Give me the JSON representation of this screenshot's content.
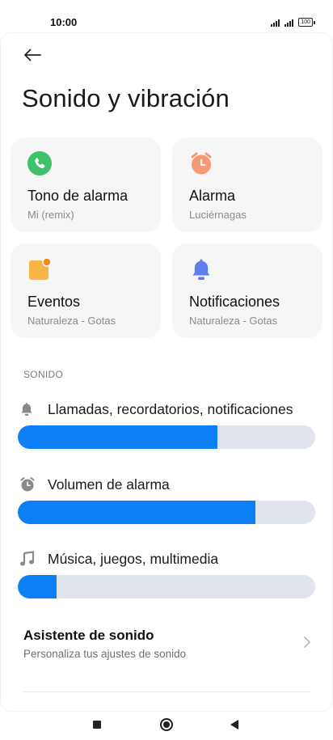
{
  "status_bar": {
    "time": "10:00",
    "battery": "100"
  },
  "header": {
    "back_icon": "arrow-left-icon",
    "title": "Sonido y vibración"
  },
  "tiles": [
    {
      "title": "Tono de alarma",
      "subtitle": "Mi (remix)",
      "icon": "phone-icon",
      "color": "#3dc26b"
    },
    {
      "title": "Alarma",
      "subtitle": "Luciérnagas",
      "icon": "alarm-clock-icon",
      "color": "#f79a73"
    },
    {
      "title": "Eventos",
      "subtitle": "Naturaleza - Gotas",
      "icon": "calendar-event-icon",
      "color": "#f7b548"
    },
    {
      "title": "Notificaciones",
      "subtitle": "Naturaleza - Gotas",
      "icon": "bell-icon",
      "color": "#5f7ef0"
    }
  ],
  "section": {
    "label": "SONIDO"
  },
  "volumes": [
    {
      "label": "Llamadas, recordatorios, notificaciones",
      "icon": "bell-icon",
      "level": 0.67
    },
    {
      "label": "Volumen de alarma",
      "icon": "alarm-clock-icon",
      "level": 0.8
    },
    {
      "label": "Música, juegos, multimedia",
      "icon": "music-note-icon",
      "level": 0.13
    }
  ],
  "assistant": {
    "title": "Asistente de sonido",
    "subtitle": "Personaliza tus ajustes de sonido"
  },
  "nav": {
    "recents_icon": "square-icon",
    "home_icon": "circle-icon",
    "back_icon": "triangle-back-icon"
  },
  "colors": {
    "accent": "#0d7ff5",
    "slider_track": "#e0e4ec",
    "tile_bg": "#f6f6f6"
  }
}
